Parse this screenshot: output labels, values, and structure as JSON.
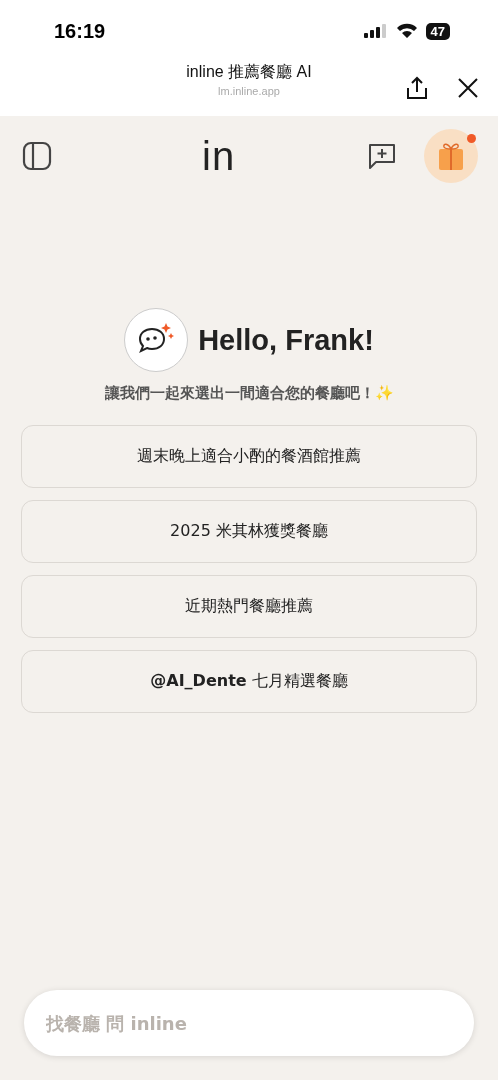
{
  "status_bar": {
    "time": "16:19",
    "battery": "47"
  },
  "browser": {
    "title": "inline 推薦餐廳 AI",
    "url": "lm.inline.app"
  },
  "app_bar": {
    "logo": "in",
    "gift_badge": true
  },
  "greeting": {
    "title": "Hello, Frank!",
    "subtitle": "讓我們一起來選出一間適合您的餐廳吧！✨"
  },
  "suggestions": [
    {
      "label": "週末晚上適合小酌的餐酒館推薦"
    },
    {
      "label": "2025 米其林獲獎餐廳"
    },
    {
      "label": "近期熱門餐廳推薦"
    },
    {
      "label": "**@AI_Dente** 七月精選餐廳"
    }
  ],
  "search": {
    "placeholder": "找餐廳 問 inline"
  }
}
